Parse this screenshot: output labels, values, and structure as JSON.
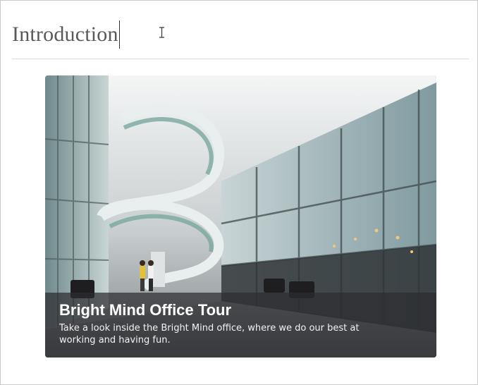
{
  "editor": {
    "heading": "Introduction"
  },
  "card": {
    "title": "Bright Mind Office Tour",
    "description": "Take a look inside the Bright Mind office, where we do our best at working and having fun.",
    "image": "office-atrium-photo"
  },
  "icons": {
    "cursor": "text-cursor-icon"
  },
  "colors": {
    "heading": "#595959",
    "overlay": "#2d2d30",
    "border": "#c9c9c9"
  }
}
